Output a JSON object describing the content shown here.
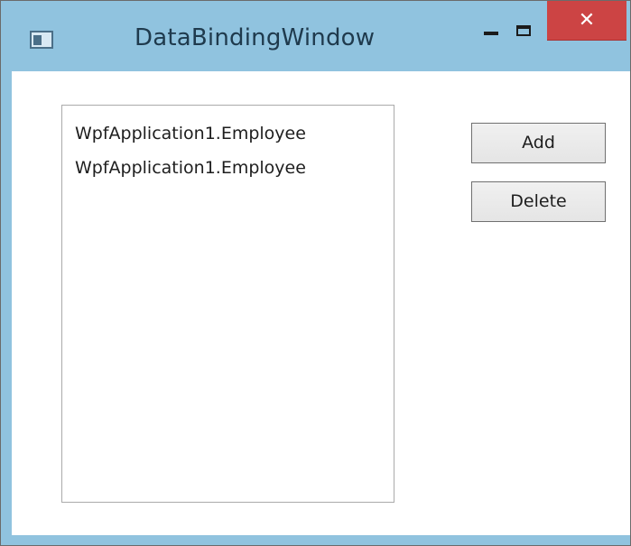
{
  "window": {
    "title": "DataBindingWindow",
    "app_icon": "window-app-icon",
    "controls": {
      "minimize_icon": "minimize-icon",
      "maximize_icon": "maximize-icon",
      "close_icon": "close-icon",
      "close_glyph": "✕"
    },
    "colors": {
      "frame": "#90c3df",
      "close_button": "#cc4444",
      "client_background": "#ffffff"
    }
  },
  "listbox": {
    "items": [
      "WpfApplication1.Employee",
      "WpfApplication1.Employee"
    ]
  },
  "buttons": {
    "add_label": "Add",
    "delete_label": "Delete"
  }
}
